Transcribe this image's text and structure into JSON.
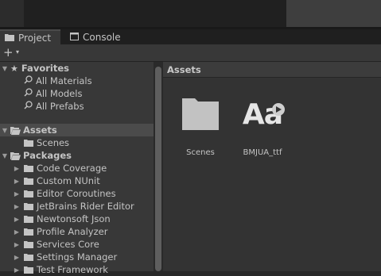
{
  "tabs": {
    "project": "Project",
    "console": "Console"
  },
  "toolbar": {
    "create_label": "+",
    "dropdown_label": "▾"
  },
  "favorites": {
    "header": "Favorites",
    "items": [
      "All Materials",
      "All Models",
      "All Prefabs"
    ]
  },
  "assets_tree": {
    "header": "Assets",
    "children": [
      "Scenes"
    ]
  },
  "packages": {
    "header": "Packages",
    "items": [
      "Code Coverage",
      "Custom NUnit",
      "Editor Coroutines",
      "JetBrains Rider Editor",
      "Newtonsoft Json",
      "Profile Analyzer",
      "Services Core",
      "Settings Manager",
      "Test Framework"
    ]
  },
  "breadcrumb": "Assets",
  "grid": {
    "items": [
      {
        "label": "Scenes",
        "type": "folder"
      },
      {
        "label": "BMJUA_ttf",
        "type": "font",
        "glyph": "Aa"
      }
    ]
  },
  "colors": {
    "selection": "#4b4b4b",
    "panel": "#383838",
    "grid_bg": "#333333"
  }
}
